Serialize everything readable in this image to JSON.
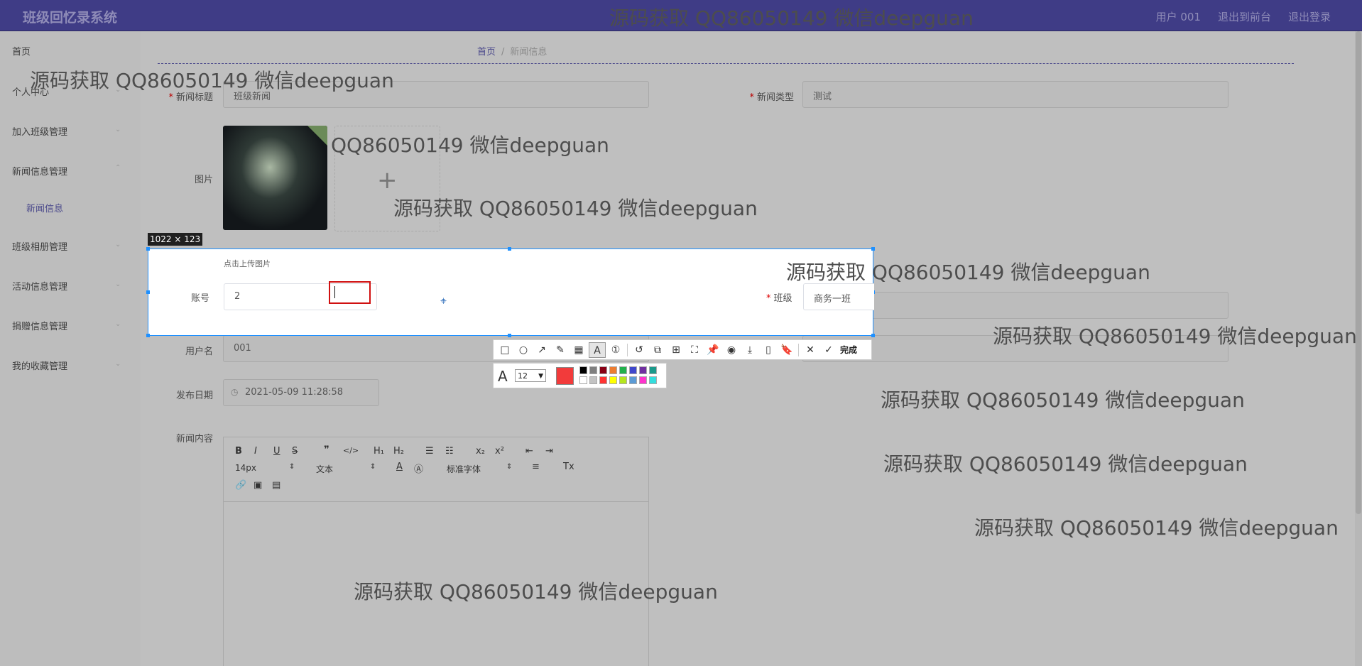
{
  "header": {
    "app_title": "班级回忆录系统",
    "user": "用户 001",
    "exit_front": "退出到前台",
    "logout": "退出登录"
  },
  "sidebar": {
    "items": [
      {
        "label": "首页"
      },
      {
        "label": "个人中心"
      },
      {
        "label": "加入班级管理"
      },
      {
        "label": "新闻信息管理"
      },
      {
        "label": "班级相册管理"
      },
      {
        "label": "活动信息管理"
      },
      {
        "label": "捐赠信息管理"
      },
      {
        "label": "我的收藏管理"
      }
    ],
    "sub_item": "新闻信息"
  },
  "breadcrumb": {
    "home": "首页",
    "sep": "/",
    "current": "新闻信息"
  },
  "form": {
    "title_label": "新闻标题",
    "title_value": "班级新闻",
    "type_label": "新闻类型",
    "type_value": "测试",
    "image_label": "图片",
    "upload_hint": "点击上传图片",
    "account_label": "账号",
    "account_value": "2",
    "class_label": "班级",
    "class_value": "商务一班",
    "username_label": "用户名",
    "username_value": "001",
    "date_label": "发布日期",
    "date_value": "2021-05-09 11:28:58",
    "content_label": "新闻内容",
    "required_mark": "*"
  },
  "editor": {
    "font_size": "14px",
    "block_type": "文本",
    "font_family": "标准字体"
  },
  "screenshot_tool": {
    "size_label": "1022 × 123",
    "done_label": "完成",
    "font_size_value": "12",
    "current_color": "#f23b3b",
    "palette_top": [
      "#000000",
      "#7f7f7f",
      "#880015",
      "#ed7d31",
      "#22b14c",
      "#3f48cc",
      "#7030a0",
      "#1b998b"
    ],
    "palette_bottom": [
      "#ffffff",
      "#c3c3c3",
      "#ff3333",
      "#ffff00",
      "#b5e61d",
      "#5b9bd5",
      "#ff33cc",
      "#33dddd"
    ]
  },
  "watermark_text": "源码获取 QQ86050149 微信deepguan",
  "watermark_partial": "QQ86050149 微信deepguan"
}
